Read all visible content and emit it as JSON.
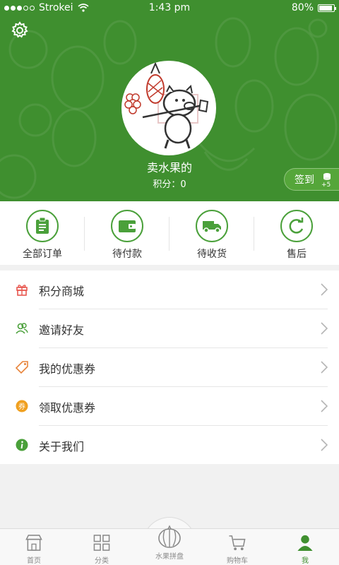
{
  "status_bar": {
    "carrier": "Strokei",
    "time": "1:43 pm",
    "battery": "80%"
  },
  "profile": {
    "name": "卖水果的",
    "points_text": "积分：0"
  },
  "signin": {
    "label": "签到",
    "bonus": "+5"
  },
  "orders": [
    {
      "label": "全部订单",
      "icon": "clipboard-icon"
    },
    {
      "label": "待付款",
      "icon": "wallet-icon"
    },
    {
      "label": "待收货",
      "icon": "truck-icon"
    },
    {
      "label": "售后",
      "icon": "refresh-icon"
    }
  ],
  "menu": [
    {
      "label": "积分商城",
      "icon": "gift-icon",
      "color": "#e8574f"
    },
    {
      "label": "邀请好友",
      "icon": "friends-icon",
      "color": "#4aa03a"
    },
    {
      "label": "我的优惠券",
      "icon": "tag-icon",
      "color": "#e8843a"
    },
    {
      "label": "领取优惠券",
      "icon": "coupon-icon",
      "color": "#f0a020"
    },
    {
      "label": "关于我们",
      "icon": "info-icon",
      "color": "#4aa03a"
    }
  ],
  "tabs": [
    {
      "label": "首页",
      "icon": "shop-icon"
    },
    {
      "label": "分类",
      "icon": "grid-icon"
    },
    {
      "label": "水果拼盘",
      "icon": "fruit-platter-icon"
    },
    {
      "label": "购物车",
      "icon": "cart-icon"
    },
    {
      "label": "我",
      "icon": "user-icon",
      "active": true
    }
  ],
  "colors": {
    "primary": "#3f8f2f",
    "accent": "#4aa03a"
  }
}
